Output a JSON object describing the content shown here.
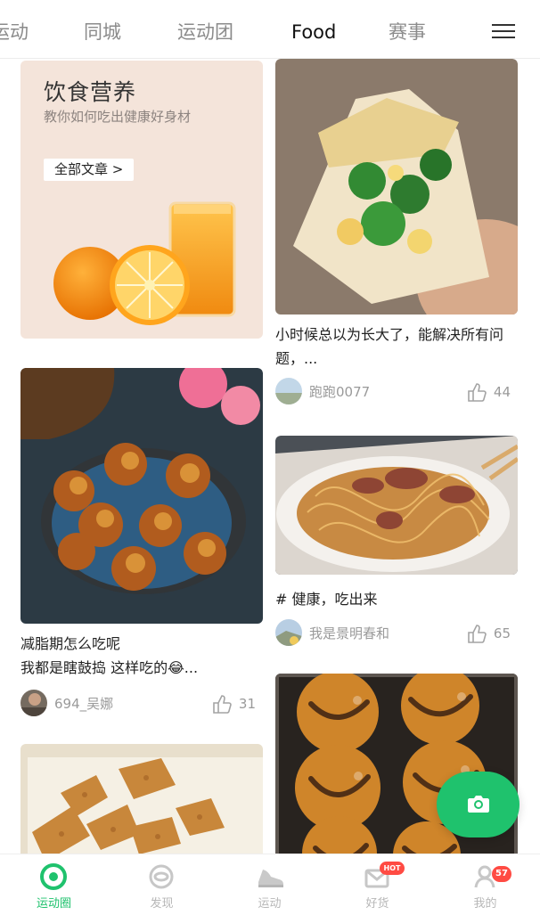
{
  "tabs": {
    "items": [
      "运动",
      "同城",
      "运动团",
      "Food",
      "赛事"
    ],
    "active": "Food"
  },
  "banner": {
    "title": "饮食营养",
    "subtitle": "教你如何吃出健康好身材",
    "button": "全部文章 >"
  },
  "posts": [
    {
      "title": "小时候总以为长大了，能解决所有问题，...",
      "author": "跑跑0077",
      "likes": "44"
    },
    {
      "title": "减脂期怎么吃呢\n我都是瞎鼓捣 这样吃的😂...",
      "author": "694_吴娜",
      "likes": "31"
    },
    {
      "title": "# 健康，吃出来",
      "author": "我是景明春和",
      "likes": "65"
    }
  ],
  "bottom_nav": {
    "items": [
      {
        "label": "运动圈",
        "icon": "circle-icon"
      },
      {
        "label": "发现",
        "icon": "compass-icon"
      },
      {
        "label": "运动",
        "icon": "shoe-icon"
      },
      {
        "label": "好货",
        "icon": "mail-icon"
      },
      {
        "label": "我的",
        "icon": "profile-icon"
      }
    ],
    "active": "运动圈",
    "hot_badge": "HOT",
    "profile_badge": "57"
  },
  "colors": {
    "accent": "#1fc26d",
    "badge": "#ff4b43"
  }
}
